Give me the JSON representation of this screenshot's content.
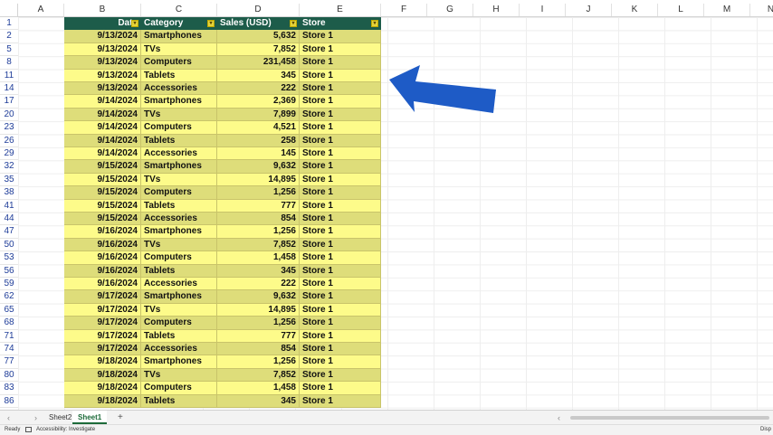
{
  "columns": [
    "A",
    "B",
    "C",
    "D",
    "E",
    "F",
    "G",
    "H",
    "I",
    "J",
    "K",
    "L",
    "M",
    "N"
  ],
  "headers": {
    "date": "Date",
    "category": "Category",
    "sales": "Sales (USD)",
    "store": "Store"
  },
  "header_row_number": "1",
  "rows": [
    {
      "n": "2",
      "date": "9/13/2024",
      "cat": "Smartphones",
      "sales": "5,632",
      "store": "Store 1"
    },
    {
      "n": "5",
      "date": "9/13/2024",
      "cat": "TVs",
      "sales": "7,852",
      "store": "Store 1"
    },
    {
      "n": "8",
      "date": "9/13/2024",
      "cat": "Computers",
      "sales": "231,458",
      "store": "Store 1"
    },
    {
      "n": "11",
      "date": "9/13/2024",
      "cat": "Tablets",
      "sales": "345",
      "store": "Store 1"
    },
    {
      "n": "14",
      "date": "9/13/2024",
      "cat": "Accessories",
      "sales": "222",
      "store": "Store 1"
    },
    {
      "n": "17",
      "date": "9/14/2024",
      "cat": "Smartphones",
      "sales": "2,369",
      "store": "Store 1"
    },
    {
      "n": "20",
      "date": "9/14/2024",
      "cat": "TVs",
      "sales": "7,899",
      "store": "Store 1"
    },
    {
      "n": "23",
      "date": "9/14/2024",
      "cat": "Computers",
      "sales": "4,521",
      "store": "Store 1"
    },
    {
      "n": "26",
      "date": "9/14/2024",
      "cat": "Tablets",
      "sales": "258",
      "store": "Store 1"
    },
    {
      "n": "29",
      "date": "9/14/2024",
      "cat": "Accessories",
      "sales": "145",
      "store": "Store 1"
    },
    {
      "n": "32",
      "date": "9/15/2024",
      "cat": "Smartphones",
      "sales": "9,632",
      "store": "Store 1"
    },
    {
      "n": "35",
      "date": "9/15/2024",
      "cat": "TVs",
      "sales": "14,895",
      "store": "Store 1"
    },
    {
      "n": "38",
      "date": "9/15/2024",
      "cat": "Computers",
      "sales": "1,256",
      "store": "Store 1"
    },
    {
      "n": "41",
      "date": "9/15/2024",
      "cat": "Tablets",
      "sales": "777",
      "store": "Store 1"
    },
    {
      "n": "44",
      "date": "9/15/2024",
      "cat": "Accessories",
      "sales": "854",
      "store": "Store 1"
    },
    {
      "n": "47",
      "date": "9/16/2024",
      "cat": "Smartphones",
      "sales": "1,256",
      "store": "Store 1"
    },
    {
      "n": "50",
      "date": "9/16/2024",
      "cat": "TVs",
      "sales": "7,852",
      "store": "Store 1"
    },
    {
      "n": "53",
      "date": "9/16/2024",
      "cat": "Computers",
      "sales": "1,458",
      "store": "Store 1"
    },
    {
      "n": "56",
      "date": "9/16/2024",
      "cat": "Tablets",
      "sales": "345",
      "store": "Store 1"
    },
    {
      "n": "59",
      "date": "9/16/2024",
      "cat": "Accessories",
      "sales": "222",
      "store": "Store 1"
    },
    {
      "n": "62",
      "date": "9/17/2024",
      "cat": "Smartphones",
      "sales": "9,632",
      "store": "Store 1"
    },
    {
      "n": "65",
      "date": "9/17/2024",
      "cat": "TVs",
      "sales": "14,895",
      "store": "Store 1"
    },
    {
      "n": "68",
      "date": "9/17/2024",
      "cat": "Computers",
      "sales": "1,256",
      "store": "Store 1"
    },
    {
      "n": "71",
      "date": "9/17/2024",
      "cat": "Tablets",
      "sales": "777",
      "store": "Store 1"
    },
    {
      "n": "74",
      "date": "9/17/2024",
      "cat": "Accessories",
      "sales": "854",
      "store": "Store 1"
    },
    {
      "n": "77",
      "date": "9/18/2024",
      "cat": "Smartphones",
      "sales": "1,256",
      "store": "Store 1"
    },
    {
      "n": "80",
      "date": "9/18/2024",
      "cat": "TVs",
      "sales": "7,852",
      "store": "Store 1"
    },
    {
      "n": "83",
      "date": "9/18/2024",
      "cat": "Computers",
      "sales": "1,458",
      "store": "Store 1"
    },
    {
      "n": "86",
      "date": "9/18/2024",
      "cat": "Tablets",
      "sales": "345",
      "store": "Store 1"
    }
  ],
  "sheets": [
    {
      "label": "Sheet2",
      "active": false
    },
    {
      "label": "Sheet1",
      "active": true
    }
  ],
  "add_sheet_label": "+",
  "status": {
    "ready": "Ready",
    "accessibility": "Accessibility: Investigate",
    "display": "Disp"
  },
  "colors": {
    "header_bg": "#1d5c4a",
    "row_odd": "#dedd7a",
    "row_even": "#fdfb8a",
    "arrow": "#1e5bc6"
  },
  "icons": {
    "filter": "filter-dropdown-icon",
    "arrow": "blue-arrow-pointer",
    "accessibility": "accessibility-icon"
  }
}
